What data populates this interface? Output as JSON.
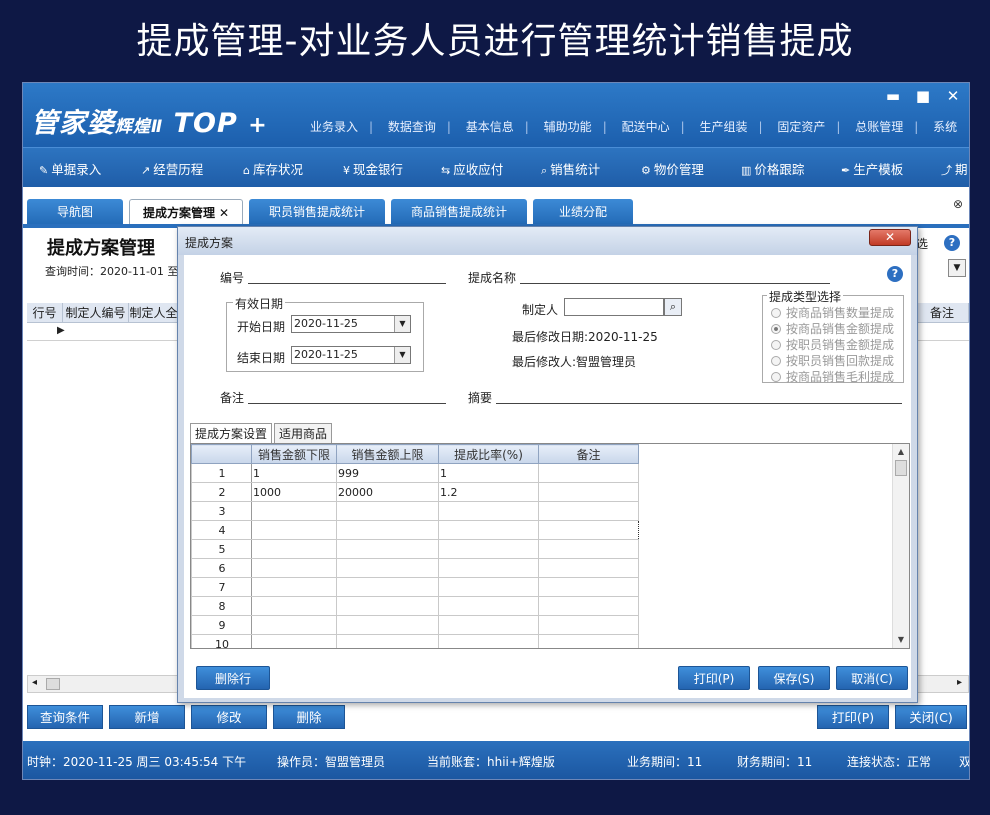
{
  "banner": "提成管理-对业务人员进行管理统计销售提成",
  "app": {
    "logo": "管家婆",
    "logo_sub": "辉煌Ⅱ",
    "logo_top": "TOP",
    "logo_plus": "+",
    "winbtns": [
      "▬",
      "■",
      "✕"
    ],
    "topmenu": [
      "业务录入",
      "数据查询",
      "基本信息",
      "辅助功能",
      "配送中心",
      "生产组装",
      "固定资产",
      "总账管理",
      "系统"
    ],
    "menu_sep": "|",
    "toolbar": [
      {
        "icon": "✎",
        "icon_name": "entry-icon",
        "label": "单据录入"
      },
      {
        "icon": "↗",
        "icon_name": "chart-icon",
        "label": "经营历程"
      },
      {
        "icon": "⌂",
        "icon_name": "warehouse-icon",
        "label": "库存状况"
      },
      {
        "icon": "¥",
        "icon_name": "yen-icon",
        "label": "现金银行"
      },
      {
        "icon": "⇆",
        "icon_name": "exchange-icon",
        "label": "应收应付"
      },
      {
        "icon": "⌕",
        "icon_name": "search-icon",
        "label": "销售统计"
      },
      {
        "icon": "⚙",
        "icon_name": "gear-icon",
        "label": "物价管理"
      },
      {
        "icon": "▥",
        "icon_name": "bar-chart-icon",
        "label": "价格跟踪"
      },
      {
        "icon": "✒",
        "icon_name": "wrench-icon",
        "label": "生产模板"
      },
      {
        "icon": "⤴",
        "icon_name": "share-icon",
        "label": "期"
      }
    ],
    "tabs": [
      {
        "label": "导航图",
        "active": false
      },
      {
        "label": "提成方案管理",
        "active": true,
        "close": "✕"
      },
      {
        "label": "职员销售提成统计",
        "active": false
      },
      {
        "label": "商品销售提成统计",
        "active": false
      },
      {
        "label": "业绩分配",
        "active": false
      }
    ],
    "close_all": "⊗",
    "page_title": "提成方案管理",
    "query_time": "查询时间：2020-11-01 至",
    "right_label": "选",
    "help": "?",
    "dropdown_arrow": "▼",
    "grid_headers": [
      "行号",
      "制定人编号",
      "制定人全"
    ],
    "grid_right_header": "备注",
    "row_pointer": "▶",
    "hscroll_left": "◂",
    "hscroll_right": "▸",
    "bottom_buttons": [
      "查询条件",
      "新增",
      "修改",
      "删除",
      "打印(P)",
      "关闭(C)"
    ],
    "status": {
      "clock": "时钟：2020-11-25 周三 03:45:54 下午",
      "operator": "操作员：智盟管理员",
      "account": "当前账套：hhii+辉煌版",
      "biz_period": "业务期间：11",
      "fin_period": "财务期间：11",
      "conn": "连接状态：正常",
      "tail": "双"
    }
  },
  "dialog": {
    "title": "提成方案",
    "close": "✕",
    "fields": {
      "code_label": "编号",
      "name_label": "提成名称",
      "valid_legend": "有效日期",
      "start_label": "开始日期",
      "start_value": "2020-11-25",
      "end_label": "结束日期",
      "end_value": "2020-11-25",
      "maker_label": "制定人",
      "maker_value": "",
      "magnifier": "⌕",
      "last_mod_date": "最后修改日期:2020-11-25",
      "last_mod_user": "最后修改人:智盟管理员",
      "remark_label": "备注",
      "summary_label": "摘要",
      "help": "?",
      "combo_arrow": "▼"
    },
    "type_legend": "提成类型选择",
    "types": [
      {
        "label": "按商品销售数量提成",
        "selected": false
      },
      {
        "label": "按商品销售金额提成",
        "selected": true
      },
      {
        "label": "按职员销售金额提成",
        "selected": false
      },
      {
        "label": "按职员销售回款提成",
        "selected": false
      },
      {
        "label": "按商品销售毛利提成",
        "selected": false
      }
    ],
    "tabs": [
      "提成方案设置",
      "适用商品"
    ],
    "grid_headers": [
      "",
      "销售金额下限",
      "销售金额上限",
      "提成比率(%)",
      "备注"
    ],
    "rows": [
      {
        "n": "1",
        "low": "1",
        "high": "999",
        "rate": "1",
        "note": ""
      },
      {
        "n": "2",
        "low": "1000",
        "high": "20000",
        "rate": "1.2",
        "note": ""
      },
      {
        "n": "3",
        "low": "",
        "high": "",
        "rate": "",
        "note": ""
      },
      {
        "n": "4",
        "low": "",
        "high": "",
        "rate": "",
        "note": ""
      },
      {
        "n": "5",
        "low": "",
        "high": "",
        "rate": "",
        "note": ""
      },
      {
        "n": "6",
        "low": "",
        "high": "",
        "rate": "",
        "note": ""
      },
      {
        "n": "7",
        "low": "",
        "high": "",
        "rate": "",
        "note": ""
      },
      {
        "n": "8",
        "low": "",
        "high": "",
        "rate": "",
        "note": ""
      },
      {
        "n": "9",
        "low": "",
        "high": "",
        "rate": "",
        "note": ""
      },
      {
        "n": "10",
        "low": "",
        "high": "",
        "rate": "",
        "note": ""
      }
    ],
    "vs_up": "▲",
    "vs_down": "▼",
    "buttons": {
      "delete_row": "删除行",
      "print": "打印(P)",
      "save": "保存(S)",
      "cancel": "取消(C)"
    }
  }
}
